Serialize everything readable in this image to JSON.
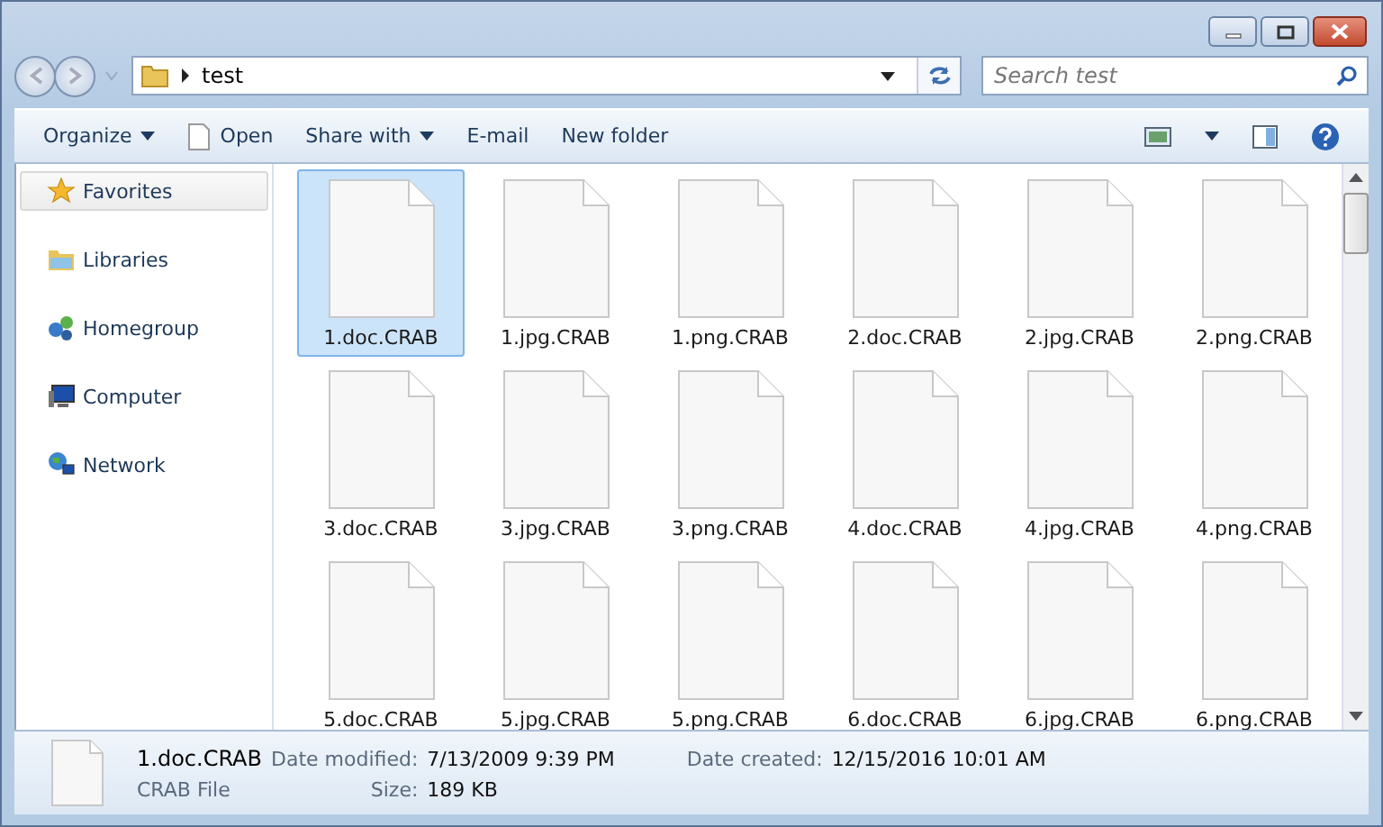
{
  "address": {
    "path": "test",
    "search_placeholder": "Search test"
  },
  "toolbar": [
    {
      "label": "Organize",
      "kind": "menu"
    },
    {
      "label": "Open",
      "kind": "icon"
    },
    {
      "label": "Share with",
      "kind": "menu"
    },
    {
      "label": "E-mail",
      "kind": "plain"
    },
    {
      "label": "New folder",
      "kind": "plain"
    }
  ],
  "sidebar": {
    "items": [
      {
        "label": "Favorites",
        "kind": "star",
        "selected": true
      },
      {
        "label": "Libraries",
        "kind": "library",
        "selected": false
      },
      {
        "label": "Homegroup",
        "kind": "homegroup",
        "selected": false
      },
      {
        "label": "Computer",
        "kind": "computer",
        "selected": false
      },
      {
        "label": "Network",
        "kind": "network",
        "selected": false
      }
    ]
  },
  "files": [
    {
      "name": "1.doc.CRAB",
      "selected": true
    },
    {
      "name": "1.jpg.CRAB",
      "selected": false
    },
    {
      "name": "1.png.CRAB",
      "selected": false
    },
    {
      "name": "2.doc.CRAB",
      "selected": false
    },
    {
      "name": "2.jpg.CRAB",
      "selected": false
    },
    {
      "name": "2.png.CRAB",
      "selected": false
    },
    {
      "name": "3.doc.CRAB",
      "selected": false
    },
    {
      "name": "3.jpg.CRAB",
      "selected": false
    },
    {
      "name": "3.png.CRAB",
      "selected": false
    },
    {
      "name": "4.doc.CRAB",
      "selected": false
    },
    {
      "name": "4.jpg.CRAB",
      "selected": false
    },
    {
      "name": "4.png.CRAB",
      "selected": false
    },
    {
      "name": "5.doc.CRAB",
      "selected": false
    },
    {
      "name": "5.jpg.CRAB",
      "selected": false
    },
    {
      "name": "5.png.CRAB",
      "selected": false
    },
    {
      "name": "6.doc.CRAB",
      "selected": false
    },
    {
      "name": "6.jpg.CRAB",
      "selected": false
    },
    {
      "name": "6.png.CRAB",
      "selected": false
    }
  ],
  "details": {
    "name": "1.doc.CRAB",
    "type": "CRAB File",
    "fields": [
      {
        "label": "Date modified:",
        "value": "7/13/2009 9:39 PM"
      },
      {
        "label": "Date created:",
        "value": "12/15/2016 10:01 AM"
      },
      {
        "label": "Size:",
        "value": "189 KB"
      }
    ]
  }
}
